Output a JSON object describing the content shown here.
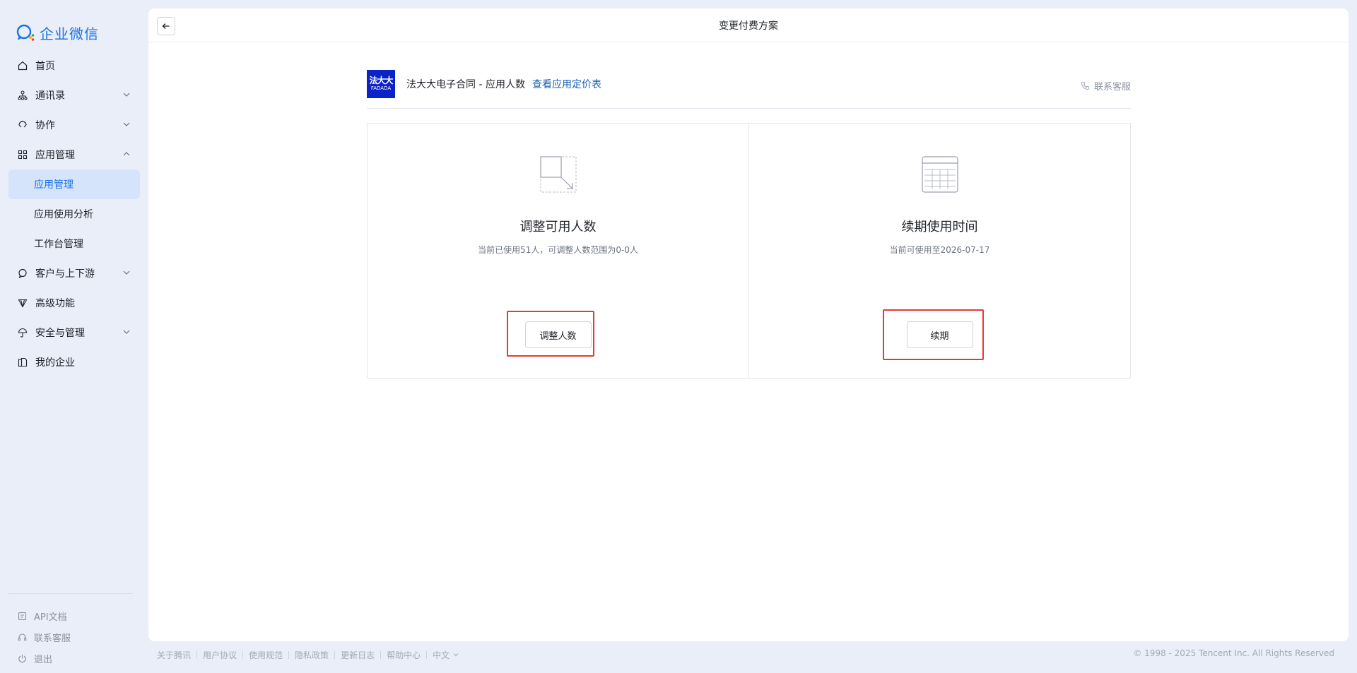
{
  "brand": {
    "name": "企业微信",
    "color": "#1a73e8"
  },
  "nav": {
    "items": [
      {
        "label": "首页",
        "icon": "home-icon"
      },
      {
        "label": "通讯录",
        "icon": "org-chart-icon",
        "expandable": true
      },
      {
        "label": "协作",
        "icon": "collaboration-icon",
        "expandable": true
      },
      {
        "label": "应用管理",
        "icon": "apps-grid-icon",
        "expandable": true,
        "expanded": true
      },
      {
        "label": "应用管理",
        "sub": true,
        "active": true
      },
      {
        "label": "应用使用分析",
        "sub": true
      },
      {
        "label": "工作台管理",
        "sub": true
      },
      {
        "label": "客户与上下游",
        "icon": "chat-bubble-icon",
        "expandable": true
      },
      {
        "label": "高级功能",
        "icon": "diamond-icon"
      },
      {
        "label": "安全与管理",
        "icon": "umbrella-icon",
        "expandable": true
      },
      {
        "label": "我的企业",
        "icon": "building-icon"
      }
    ]
  },
  "sidebar_bottom": {
    "api_docs": "API文档",
    "support": "联系客服",
    "logout": "退出"
  },
  "header": {
    "title": "变更付费方案"
  },
  "app": {
    "logo_line1": "法大大",
    "logo_line2": "FADADA",
    "logo_color": "#0b22c7",
    "name": "法大大电子合同 - 应用人数",
    "pricing_link": "查看应用定价表",
    "support_link": "联系客服"
  },
  "cards": {
    "adjust": {
      "title": "调整可用人数",
      "desc": "当前已使用51人，可调整人数范围为0-0人",
      "button": "调整人数"
    },
    "renew": {
      "title": "续期使用时间",
      "desc": "当前可使用至2026-07-17",
      "button": "续期"
    }
  },
  "footer": {
    "links": [
      "关于腾讯",
      "用户协议",
      "使用规范",
      "隐私政策",
      "更新日志",
      "帮助中心"
    ],
    "language": "中文",
    "copyright": "© 1998 - 2025 Tencent Inc. All Rights Reserved"
  },
  "colors": {
    "accent": "#1a73e8",
    "highlight": "#e53935",
    "link": "#1a5fb4"
  }
}
